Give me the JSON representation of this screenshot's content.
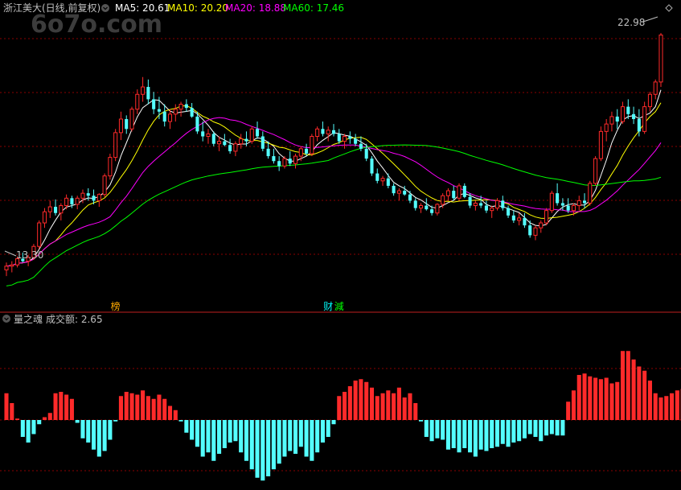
{
  "watermark": "6o7o.com",
  "price_panel": {
    "title": "浙江美大(日线,前复权)",
    "ma_labels": [
      {
        "text": "MA5: 20.61",
        "color": "#ffffff"
      },
      {
        "text": "MA10: 20.20",
        "color": "#ffff00"
      },
      {
        "text": "MA20: 18.88",
        "color": "#ff00ff"
      },
      {
        "text": "MA60: 17.46",
        "color": "#00ff00"
      }
    ],
    "high_label": "22.98",
    "low_label": "13.30",
    "markers": [
      {
        "text": "榜",
        "color": "#ffaa00",
        "bar": 20
      },
      {
        "text": "财",
        "color": "#00ffff",
        "bar": 59
      },
      {
        "text": "減",
        "color": "#00ff00",
        "bar": 61
      }
    ]
  },
  "volume_panel": {
    "title": "量之魂",
    "value_label": "成交额: 2.65"
  },
  "colors": {
    "up": "#ff2a2a",
    "down": "#54ffff",
    "grid": "#8b0000",
    "ma5": "#ffffff",
    "ma10": "#ffff00",
    "ma20": "#ff00ff",
    "ma60": "#00ff00",
    "label_gray": "#c0c0c0"
  },
  "chart_data": [
    {
      "type": "candlestick",
      "ylim": [
        12.6,
        23.6
      ],
      "candles": [
        [
          13.4,
          13.7,
          13.15,
          13.55
        ],
        [
          13.55,
          13.75,
          13.3,
          13.6
        ],
        [
          13.6,
          13.95,
          13.5,
          13.85
        ],
        [
          13.85,
          14.1,
          13.7,
          13.75
        ],
        [
          13.75,
          14.0,
          13.55,
          13.9
        ],
        [
          13.9,
          14.45,
          13.8,
          14.35
        ],
        [
          14.35,
          15.4,
          14.25,
          15.3
        ],
        [
          15.3,
          15.9,
          15.1,
          15.75
        ],
        [
          15.75,
          16.2,
          15.5,
          15.95
        ],
        [
          15.95,
          16.25,
          15.6,
          15.7
        ],
        [
          15.7,
          16.1,
          15.4,
          16.0
        ],
        [
          16.0,
          16.45,
          15.85,
          16.3
        ],
        [
          16.3,
          16.4,
          15.9,
          16.05
        ],
        [
          16.05,
          16.4,
          15.85,
          16.3
        ],
        [
          16.3,
          16.65,
          16.1,
          16.5
        ],
        [
          16.5,
          16.7,
          16.2,
          16.4
        ],
        [
          16.4,
          16.65,
          16.05,
          16.2
        ],
        [
          16.2,
          16.5,
          15.95,
          16.45
        ],
        [
          16.45,
          17.3,
          16.35,
          17.2
        ],
        [
          17.2,
          18.1,
          17.05,
          17.95
        ],
        [
          17.95,
          19.1,
          17.8,
          18.95
        ],
        [
          18.95,
          19.8,
          18.65,
          19.5
        ],
        [
          19.5,
          19.65,
          18.9,
          19.1
        ],
        [
          19.1,
          20.0,
          19.0,
          19.9
        ],
        [
          19.9,
          20.7,
          19.7,
          20.5
        ],
        [
          20.5,
          21.2,
          20.2,
          20.8
        ],
        [
          20.8,
          21.1,
          20.1,
          20.3
        ],
        [
          20.3,
          20.6,
          19.7,
          19.9
        ],
        [
          19.9,
          20.4,
          19.5,
          19.8
        ],
        [
          19.8,
          20.1,
          19.2,
          19.4
        ],
        [
          19.4,
          19.9,
          19.1,
          19.7
        ],
        [
          19.7,
          20.1,
          19.4,
          19.9
        ],
        [
          19.9,
          20.2,
          19.6,
          20.1
        ],
        [
          20.1,
          20.3,
          19.8,
          19.95
        ],
        [
          19.95,
          20.15,
          19.55,
          19.6
        ],
        [
          19.6,
          19.8,
          18.9,
          19.0
        ],
        [
          19.0,
          19.4,
          18.6,
          18.8
        ],
        [
          18.8,
          19.1,
          18.5,
          18.9
        ],
        [
          18.9,
          19.0,
          18.4,
          18.5
        ],
        [
          18.5,
          18.8,
          18.2,
          18.6
        ],
        [
          18.6,
          18.9,
          18.4,
          18.45
        ],
        [
          18.45,
          18.7,
          18.1,
          18.2
        ],
        [
          18.2,
          18.6,
          18.0,
          18.5
        ],
        [
          18.5,
          18.9,
          18.3,
          18.7
        ],
        [
          18.7,
          19.0,
          18.4,
          18.6
        ],
        [
          18.6,
          19.2,
          18.5,
          19.1
        ],
        [
          19.1,
          19.4,
          18.7,
          18.8
        ],
        [
          18.8,
          19.0,
          18.2,
          18.3
        ],
        [
          18.3,
          18.6,
          17.9,
          18.0
        ],
        [
          18.0,
          18.3,
          17.7,
          17.8
        ],
        [
          17.8,
          18.0,
          17.4,
          17.6
        ],
        [
          17.6,
          18.0,
          17.5,
          17.9
        ],
        [
          17.9,
          18.2,
          17.6,
          17.7
        ],
        [
          17.7,
          18.1,
          17.5,
          18.0
        ],
        [
          18.0,
          18.4,
          17.8,
          18.3
        ],
        [
          18.3,
          18.5,
          18.0,
          18.1
        ],
        [
          18.1,
          18.9,
          18.0,
          18.8
        ],
        [
          18.8,
          19.2,
          18.6,
          19.1
        ],
        [
          19.1,
          19.4,
          18.8,
          18.9
        ],
        [
          18.9,
          19.2,
          18.6,
          19.05
        ],
        [
          19.05,
          19.3,
          18.8,
          18.9
        ],
        [
          18.9,
          19.1,
          18.5,
          18.6
        ],
        [
          18.6,
          18.9,
          18.3,
          18.8
        ],
        [
          18.8,
          19.0,
          18.5,
          18.7
        ],
        [
          18.7,
          18.9,
          18.4,
          18.5
        ],
        [
          18.5,
          18.8,
          18.2,
          18.3
        ],
        [
          18.3,
          18.5,
          17.8,
          17.9
        ],
        [
          17.9,
          18.0,
          17.2,
          17.3
        ],
        [
          17.3,
          17.5,
          16.9,
          17.0
        ],
        [
          17.0,
          17.2,
          16.8,
          17.1
        ],
        [
          17.1,
          17.3,
          16.7,
          16.8
        ],
        [
          16.8,
          16.9,
          16.4,
          16.5
        ],
        [
          16.5,
          16.7,
          16.2,
          16.6
        ],
        [
          16.6,
          16.8,
          16.4,
          16.45
        ],
        [
          16.45,
          16.6,
          16.1,
          16.2
        ],
        [
          16.2,
          16.3,
          15.8,
          15.9
        ],
        [
          15.9,
          16.1,
          15.7,
          16.0
        ],
        [
          16.0,
          16.3,
          15.8,
          15.85
        ],
        [
          15.85,
          16.0,
          15.6,
          15.7
        ],
        [
          15.7,
          16.1,
          15.6,
          16.05
        ],
        [
          16.05,
          16.5,
          15.9,
          16.4
        ],
        [
          16.4,
          16.7,
          16.2,
          16.6
        ],
        [
          16.6,
          16.8,
          16.2,
          16.3
        ],
        [
          16.3,
          16.9,
          16.2,
          16.8
        ],
        [
          16.8,
          16.9,
          16.3,
          16.35
        ],
        [
          16.35,
          16.5,
          15.9,
          16.0
        ],
        [
          16.0,
          16.2,
          15.8,
          16.1
        ],
        [
          16.1,
          16.4,
          15.9,
          16.0
        ],
        [
          16.0,
          16.2,
          15.7,
          15.8
        ],
        [
          15.8,
          16.0,
          15.5,
          15.9
        ],
        [
          15.9,
          16.3,
          15.8,
          16.2
        ],
        [
          16.2,
          16.4,
          15.8,
          15.9
        ],
        [
          15.9,
          16.0,
          15.5,
          15.6
        ],
        [
          15.6,
          15.8,
          15.3,
          15.4
        ],
        [
          15.4,
          15.7,
          15.2,
          15.5
        ],
        [
          15.5,
          15.7,
          15.1,
          15.2
        ],
        [
          15.2,
          15.4,
          14.7,
          14.8
        ],
        [
          14.8,
          15.2,
          14.6,
          15.1
        ],
        [
          15.1,
          15.4,
          14.9,
          15.3
        ],
        [
          15.3,
          15.9,
          15.2,
          15.8
        ],
        [
          15.8,
          16.6,
          15.7,
          16.5
        ],
        [
          16.5,
          16.9,
          16.0,
          16.1
        ],
        [
          16.1,
          16.3,
          15.8,
          16.0
        ],
        [
          16.0,
          16.3,
          15.7,
          15.8
        ],
        [
          15.8,
          16.1,
          15.6,
          16.0
        ],
        [
          16.0,
          16.4,
          15.8,
          16.2
        ],
        [
          16.2,
          16.5,
          15.9,
          16.1
        ],
        [
          16.1,
          17.0,
          16.0,
          16.9
        ],
        [
          16.9,
          18.0,
          16.8,
          17.9
        ],
        [
          17.9,
          19.2,
          17.8,
          19.0
        ],
        [
          19.0,
          19.5,
          18.6,
          19.3
        ],
        [
          19.3,
          19.8,
          19.0,
          19.6
        ],
        [
          19.6,
          19.9,
          19.1,
          19.4
        ],
        [
          19.4,
          20.2,
          19.3,
          20.0
        ],
        [
          20.0,
          20.3,
          19.5,
          19.7
        ],
        [
          19.7,
          20.0,
          19.3,
          19.5
        ],
        [
          19.5,
          19.9,
          18.8,
          19.0
        ],
        [
          19.0,
          20.2,
          18.9,
          20.0
        ],
        [
          20.0,
          20.6,
          19.8,
          20.5
        ],
        [
          20.5,
          21.1,
          20.3,
          21.0
        ],
        [
          21.0,
          22.98,
          20.8,
          22.9
        ]
      ],
      "ma_periods": [
        5,
        10,
        20,
        60
      ]
    },
    {
      "type": "bar",
      "series": [
        {
          "name": "成交额",
          "values": [
            1.9,
            1.2,
            0.1,
            -1.2,
            -1.6,
            -1.0,
            -0.3,
            0.2,
            0.5,
            1.9,
            2.0,
            1.8,
            1.5,
            -0.2,
            -1.3,
            -1.6,
            -2.1,
            -2.6,
            -2.2,
            -1.4,
            -0.1,
            1.7,
            2.0,
            1.9,
            1.8,
            2.1,
            1.7,
            1.5,
            1.8,
            1.5,
            1.0,
            0.7,
            -0.1,
            -0.9,
            -1.4,
            -1.9,
            -2.6,
            -2.3,
            -2.9,
            -2.4,
            -2.0,
            -1.6,
            -1.5,
            -2.3,
            -2.9,
            -3.5,
            -4.1,
            -4.3,
            -4.0,
            -3.5,
            -3.1,
            -2.6,
            -2.2,
            -2.4,
            -1.9,
            -2.6,
            -2.9,
            -2.3,
            -1.6,
            -1.2,
            -0.3,
            1.7,
            2.0,
            2.4,
            2.8,
            2.9,
            2.7,
            2.3,
            1.7,
            1.9,
            2.1,
            1.9,
            2.3,
            1.6,
            1.9,
            1.2,
            -0.1,
            -1.2,
            -1.5,
            -1.3,
            -1.4,
            -2.1,
            -2.0,
            -2.3,
            -2.0,
            -2.3,
            -2.6,
            -2.1,
            -2.2,
            -2.0,
            -1.9,
            -1.7,
            -1.9,
            -1.6,
            -1.5,
            -1.3,
            -1.0,
            -1.2,
            -1.5,
            -1.1,
            -1.0,
            -1.1,
            -1.1,
            1.3,
            2.1,
            3.2,
            3.3,
            3.1,
            3.0,
            2.9,
            3.0,
            2.6,
            2.7,
            4.9,
            4.9,
            4.3,
            3.8,
            3.5,
            2.8,
            1.9,
            1.6,
            1.7,
            1.9,
            2.1,
            2.2,
            1.2
          ]
        }
      ]
    }
  ]
}
